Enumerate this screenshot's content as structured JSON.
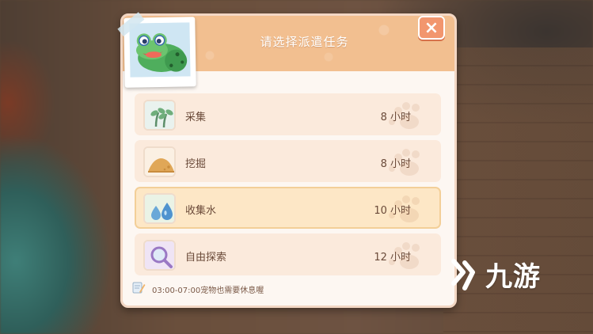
{
  "dialog": {
    "title": "请选择派遣任务",
    "close_label": "×"
  },
  "tasks": [
    {
      "name": "采集",
      "duration": "8 小时",
      "icon": "sprout-icon",
      "selected": false
    },
    {
      "name": "挖掘",
      "duration": "8 小时",
      "icon": "dirt-mound-icon",
      "selected": false
    },
    {
      "name": "收集水",
      "duration": "10 小时",
      "icon": "water-drops-icon",
      "selected": true
    },
    {
      "name": "自由探索",
      "duration": "12 小时",
      "icon": "magnifier-icon",
      "selected": false
    }
  ],
  "footer": {
    "note": "03:00-07:00宠物也需要休息喔",
    "icon": "note-pencil-icon"
  },
  "watermark": {
    "text": "九游",
    "logo": "jiuyou-logo"
  },
  "colors": {
    "header": "#f2bf90",
    "close_button": "#f2966e",
    "row": "#fbeadc",
    "row_selected": "#fde7c6",
    "text": "#6a4a39"
  }
}
